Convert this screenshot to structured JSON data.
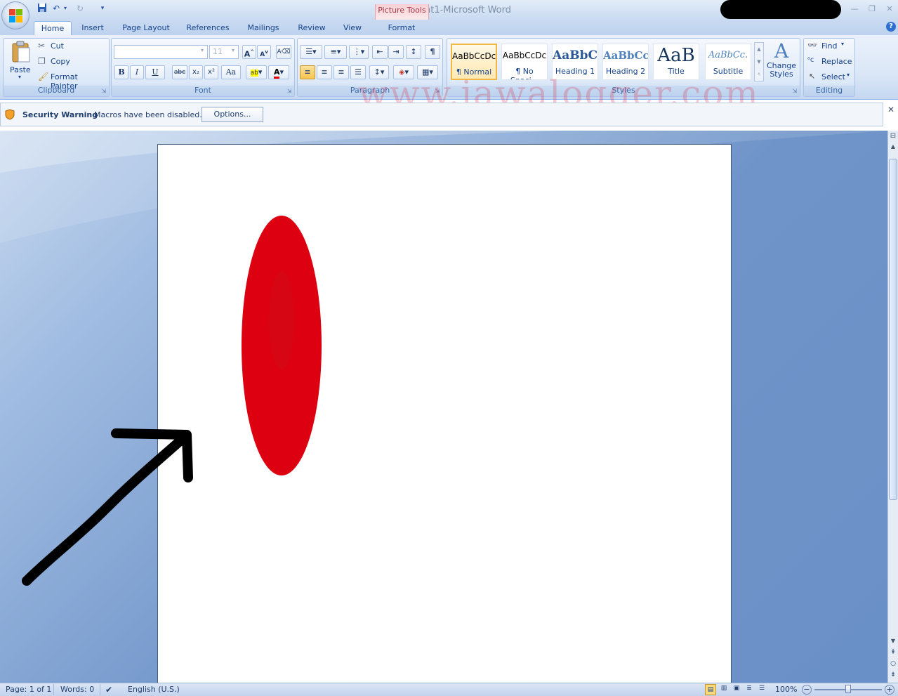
{
  "window": {
    "document_name": "Document1",
    "separator": " - ",
    "app_name": "Microsoft Word",
    "contextual_tab_group": "Picture Tools"
  },
  "tabs": [
    "Home",
    "Insert",
    "Page Layout",
    "References",
    "Mailings",
    "Review",
    "View",
    "Format"
  ],
  "active_tab": "Home",
  "ribbon": {
    "clipboard": {
      "label": "Clipboard",
      "paste": "Paste",
      "cut": "Cut",
      "copy": "Copy",
      "format_painter": "Format Painter"
    },
    "font": {
      "label": "Font",
      "font_name": "",
      "font_size": "11",
      "bold": "B",
      "italic": "I",
      "underline": "U",
      "strikethrough": "abc",
      "subscript": "x₂",
      "superscript": "x²",
      "change_case": "Aa"
    },
    "paragraph": {
      "label": "Paragraph"
    },
    "styles": {
      "label": "Styles",
      "items": [
        {
          "preview": "AaBbCcDc",
          "name": "¶ Normal"
        },
        {
          "preview": "AaBbCcDc",
          "name": "¶ No Spaci..."
        },
        {
          "preview": "AaBbCc",
          "name": "Heading 1"
        },
        {
          "preview": "AaBbCc",
          "name": "Heading 2"
        },
        {
          "preview": "AaB",
          "name": "Title"
        },
        {
          "preview": "AaBbCc.",
          "name": "Subtitle"
        }
      ],
      "change_styles": "Change Styles"
    },
    "editing": {
      "label": "Editing",
      "find": "Find",
      "replace": "Replace",
      "select": "Select"
    }
  },
  "watermark": "www.jawalogger.com",
  "security_bar": {
    "title": "Security Warning",
    "message": "Macros have been disabled.",
    "button": "Options..."
  },
  "status_bar": {
    "page": "Page: 1 of 1",
    "words": "Words: 0",
    "language": "English (U.S.)",
    "zoom": "100%"
  },
  "colors": {
    "shape_fill": "#dc0010",
    "accent_blue": "#15428b",
    "doc_background": "#6a90c8"
  }
}
